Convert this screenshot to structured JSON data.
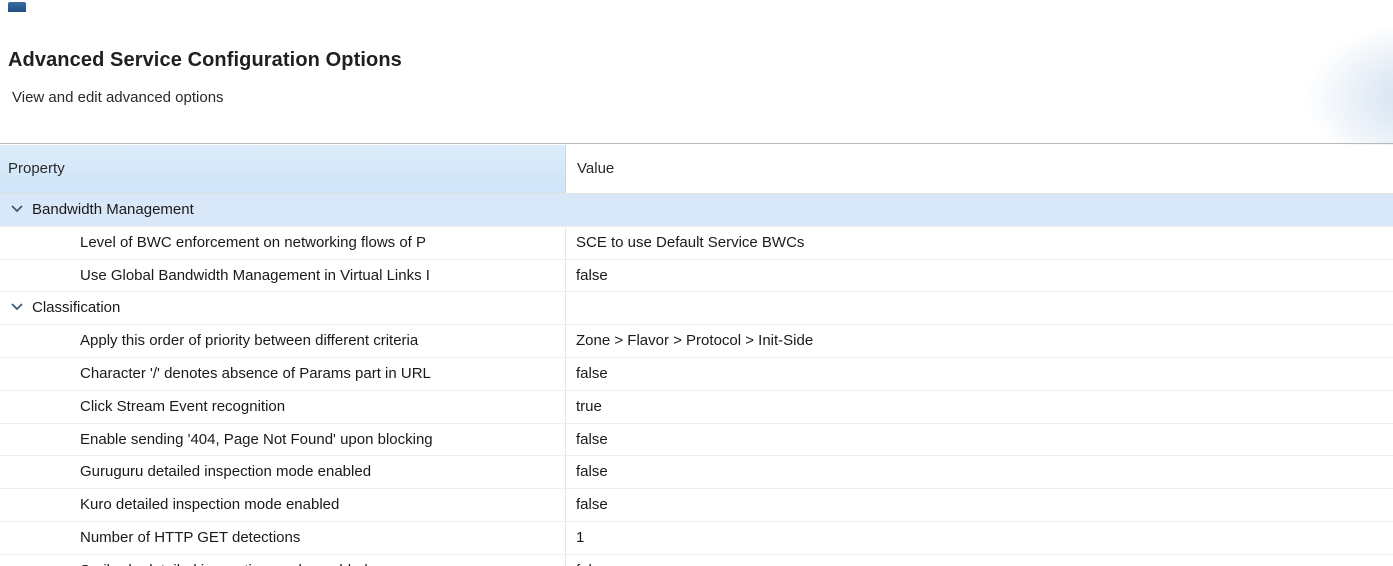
{
  "window": {
    "app_icon": "app-icon",
    "title_fragment": "                    ,           ,"
  },
  "banner": {
    "title": "Advanced Service Configuration Options",
    "description": "View and edit advanced options"
  },
  "table": {
    "columns": {
      "property": "Property",
      "value": "Value"
    },
    "categories": [
      {
        "label": "Bandwidth Management",
        "icon": "chevron-down-icon",
        "expanded": true,
        "selected": true,
        "rows": [
          {
            "property": "Level of BWC enforcement on networking flows of P",
            "value": "SCE to use Default Service BWCs"
          },
          {
            "property": "Use Global Bandwidth Management in Virtual Links I",
            "value": "false"
          }
        ]
      },
      {
        "label": "Classification",
        "icon": "chevron-down-icon",
        "expanded": true,
        "selected": false,
        "rows": [
          {
            "property": "Apply this order of priority between different criteria",
            "value": "Zone > Flavor > Protocol > Init-Side"
          },
          {
            "property": "Character '/' denotes absence of Params part in URL",
            "value": "false"
          },
          {
            "property": "Click Stream Event recognition",
            "value": "true"
          },
          {
            "property": "Enable sending '404, Page Not Found' upon blocking",
            "value": "false"
          },
          {
            "property": "Guruguru detailed inspection mode enabled",
            "value": "false"
          },
          {
            "property": "Kuro detailed inspection mode enabled",
            "value": "false"
          },
          {
            "property": "Number of HTTP GET detections",
            "value": "1"
          },
          {
            "property": "Soribada detailed inspection mode enabled",
            "value": "false"
          }
        ]
      }
    ]
  },
  "colors": {
    "header_bg": "#d6e8fa",
    "selected_row_bg": "#d9e8f8",
    "chevron": "#3c5a78"
  }
}
